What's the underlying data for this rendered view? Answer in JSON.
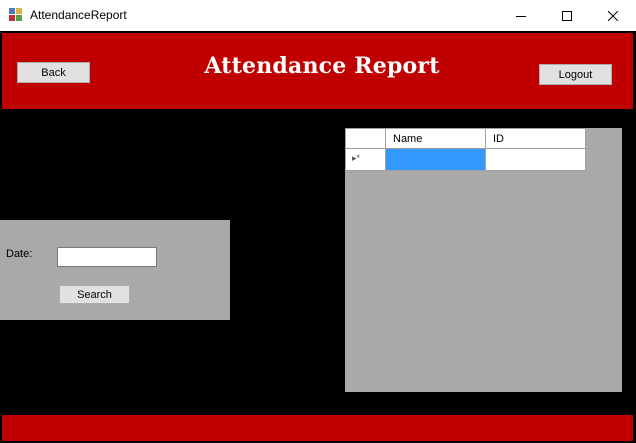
{
  "window": {
    "title": "AttendanceReport",
    "controls": [
      "minimize",
      "maximize",
      "close"
    ]
  },
  "header": {
    "back_label": "Back",
    "title": "Attendance Report",
    "logout_label": "Logout"
  },
  "search": {
    "date_label": "Date:",
    "date_value": "",
    "search_label": "Search"
  },
  "grid": {
    "columns": [
      "Name",
      "ID"
    ],
    "new_row_indicator": "▸*"
  },
  "colors": {
    "band": "#c00000",
    "panel": "#a9a9a9",
    "selection": "#3399ff"
  }
}
